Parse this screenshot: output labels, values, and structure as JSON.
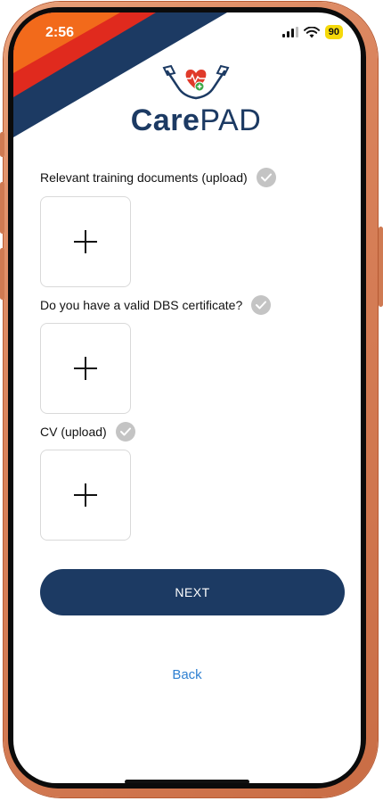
{
  "status": {
    "time": "2:56",
    "battery": "90",
    "icons": [
      "signal-icon",
      "wifi-icon"
    ]
  },
  "brand": {
    "name_part1": "Care",
    "name_part2": "PAD",
    "logo_icon": "hands-heart-icon",
    "primary_color": "#1c3a63",
    "accent_red": "#e03a2a",
    "accent_orange": "#f26a1b",
    "accent_green": "#3aa845"
  },
  "form": {
    "sections": [
      {
        "label": "Relevant training documents (upload)",
        "checked": true,
        "upload_icon": "plus-icon"
      },
      {
        "label": "Do you have a valid DBS certificate?",
        "checked": true,
        "upload_icon": "plus-icon"
      },
      {
        "label": "CV (upload)",
        "checked": true,
        "upload_icon": "plus-icon"
      }
    ]
  },
  "actions": {
    "next_label": "NEXT",
    "back_label": "Back",
    "link_color": "#2f80d1"
  }
}
